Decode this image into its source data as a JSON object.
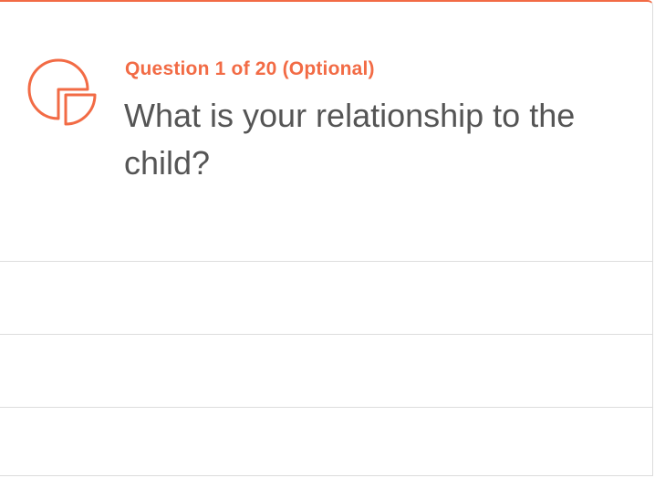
{
  "question": {
    "meta": "Question 1 of 20 (Optional)",
    "title": "What is your relationship to the child?",
    "icon": "pie-chart-icon"
  },
  "options": [
    {
      "label": ""
    },
    {
      "label": ""
    },
    {
      "label": ""
    }
  ],
  "colors": {
    "accent": "#f26b45",
    "title_text": "#555555",
    "divider": "#dddddd"
  }
}
